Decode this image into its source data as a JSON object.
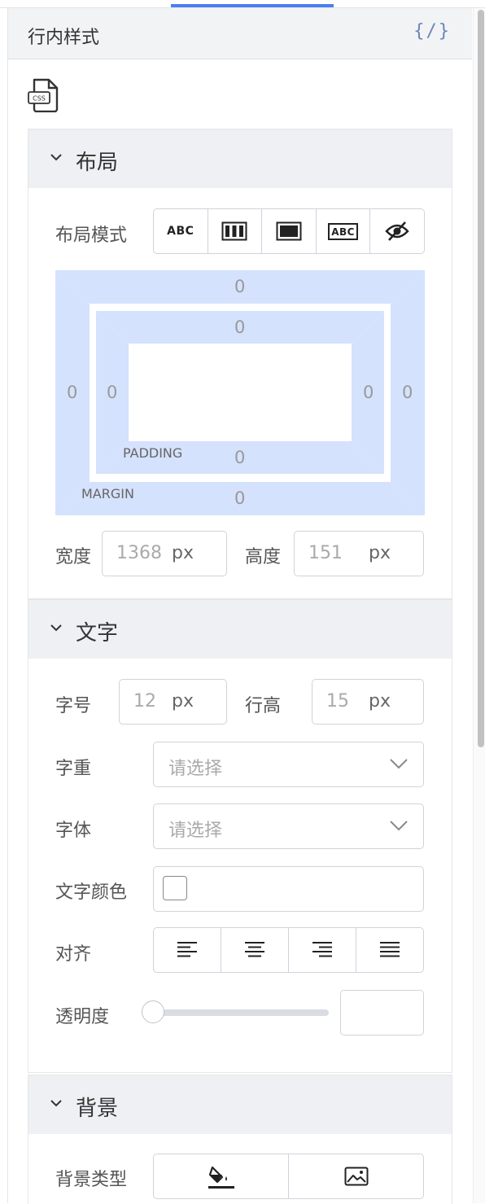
{
  "header": {
    "title": "行内样式",
    "code_icon": "{/}"
  },
  "icons": {
    "css_file": "CSS"
  },
  "layout_section": {
    "title": "布局",
    "mode_label": "布局模式",
    "modes": [
      "ABC",
      "flex-columns-icon",
      "block-icon",
      "ABC",
      "eye-off-icon"
    ],
    "box": {
      "margin": {
        "top": "0",
        "right": "0",
        "bottom": "0",
        "left": "0",
        "label": "MARGIN"
      },
      "padding": {
        "top": "0",
        "right": "0",
        "bottom": "0",
        "left": "0",
        "label": "PADDING"
      }
    },
    "width_label": "宽度",
    "width_value": "1368",
    "width_unit": "px",
    "height_label": "高度",
    "height_value": "151",
    "height_unit": "px"
  },
  "text_section": {
    "title": "文字",
    "font_size_label": "字号",
    "font_size_value": "12",
    "font_size_unit": "px",
    "line_height_label": "行高",
    "line_height_value": "15",
    "line_height_unit": "px",
    "weight_label": "字重",
    "weight_placeholder": "请选择",
    "family_label": "字体",
    "family_placeholder": "请选择",
    "color_label": "文字颜色",
    "align_label": "对齐",
    "align_options": [
      "align-left-icon",
      "align-center-icon",
      "align-right-icon",
      "align-justify-icon"
    ],
    "opacity_label": "透明度",
    "opacity_value": 0
  },
  "background_section": {
    "title": "背景",
    "type_label": "背景类型",
    "type_options": [
      "fill-color-icon",
      "image-icon"
    ]
  },
  "colors": {
    "accent": "#4a7ff0",
    "box_fill": "#d5e2fd",
    "section_head": "#eef0f3"
  }
}
